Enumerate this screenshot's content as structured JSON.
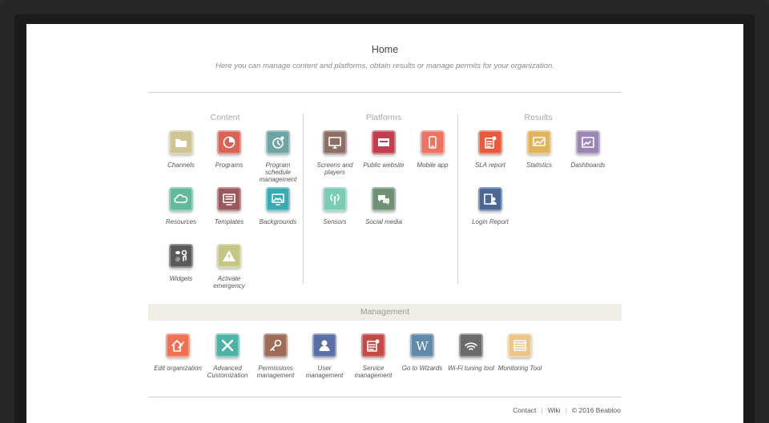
{
  "header": {
    "title": "Home",
    "subtitle": "Here you can manage content and platforms, obtain results or manage permits for your organization."
  },
  "sections": {
    "content": "Content",
    "platforms": "Platforms",
    "results": "Results",
    "management": "Management"
  },
  "content_items": [
    {
      "label": "Channels",
      "icon": "folder-icon",
      "color": "#cfc493"
    },
    {
      "label": "Programs",
      "icon": "pie-chart-icon",
      "color": "#d86458"
    },
    {
      "label": "Program schedule management",
      "icon": "schedule-icon",
      "color": "#6fa3a4"
    },
    {
      "label": "Resources",
      "icon": "cloud-icon",
      "color": "#62b99b"
    },
    {
      "label": "Templates",
      "icon": "template-icon",
      "color": "#9a585d"
    },
    {
      "label": "Backgrounds",
      "icon": "background-icon",
      "color": "#3aa9b2"
    },
    {
      "label": "Widgets",
      "icon": "widgets-icon",
      "color": "#5a5a5a"
    },
    {
      "label": "Activate emergency",
      "icon": "warning-icon",
      "color": "#c5c585"
    }
  ],
  "platform_items": [
    {
      "label": "Screens and players",
      "icon": "monitor-icon",
      "color": "#8e6f66"
    },
    {
      "label": "Public website",
      "icon": "website-icon",
      "color": "#c23d4d"
    },
    {
      "label": "Mobile app",
      "icon": "mobile-icon",
      "color": "#ec7463"
    },
    {
      "label": "Sensors",
      "icon": "sensor-icon",
      "color": "#7bcbb6"
    },
    {
      "label": "Social media",
      "icon": "chat-icon",
      "color": "#6f9175"
    }
  ],
  "result_items": [
    {
      "label": "SLA report",
      "icon": "report-icon",
      "color": "#e85a3c"
    },
    {
      "label": "Statistics",
      "icon": "statistics-icon",
      "color": "#e1b35c"
    },
    {
      "label": "Dashboards",
      "icon": "dashboard-icon",
      "color": "#9b85b5"
    },
    {
      "label": "Login Report",
      "icon": "user-report-icon",
      "color": "#4a6796"
    }
  ],
  "management_items": [
    {
      "label": "Edit organization",
      "icon": "edit-home-icon",
      "color": "#ee7355"
    },
    {
      "label": "Advanced Customization",
      "icon": "tools-icon",
      "color": "#4fb2a7"
    },
    {
      "label": "Permissions management",
      "icon": "key-icon",
      "color": "#9d6b58"
    },
    {
      "label": "User management",
      "icon": "user-icon",
      "color": "#5a6fa5"
    },
    {
      "label": "Service management",
      "icon": "service-icon",
      "color": "#c34b45"
    },
    {
      "label": "Go to Wizards",
      "icon": "wizard-icon",
      "color": "#6189a9"
    },
    {
      "label": "Wi-Fi tuning tool",
      "icon": "wifi-icon",
      "color": "#6a6a6a"
    },
    {
      "label": "Monitoring Tool",
      "icon": "monitoring-icon",
      "color": "#ecc689"
    }
  ],
  "footer": {
    "contact": "Contact",
    "wiki": "Wiki",
    "separator": "|",
    "copyright": "© 2016 Beabloo"
  }
}
